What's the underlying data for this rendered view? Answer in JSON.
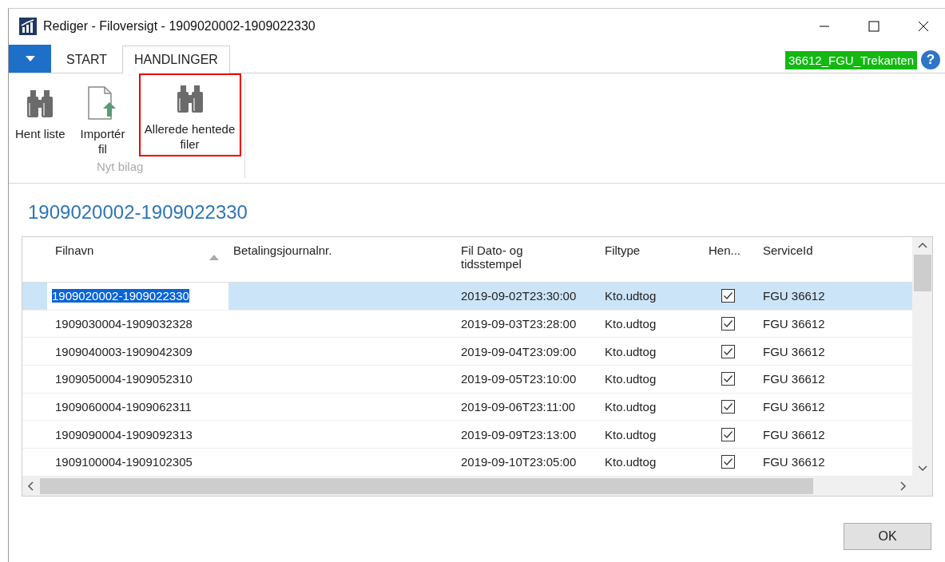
{
  "window": {
    "title": "Rediger - Filoversigt - 1909020002-1909022330"
  },
  "tabs": [
    {
      "label": "START",
      "selected": false
    },
    {
      "label": "HANDLINGER",
      "selected": true
    }
  ],
  "company_badge": "36612_FGU_Trekanten",
  "help_button": "?",
  "ribbon": {
    "actions": [
      {
        "label": "Hent liste",
        "kind": "binoculars",
        "highlighted": false
      },
      {
        "label": "Importér fil",
        "kind": "import",
        "highlighted": false
      },
      {
        "label": "Allerede hentede filer",
        "kind": "binoculars",
        "highlighted": true
      }
    ],
    "group_label": "Nyt bilag"
  },
  "page_title": "1909020002-1909022330",
  "table": {
    "columns": [
      "Filnavn",
      "Betalingsjournalnr.",
      "Fil Dato- og tidsstempel",
      "Filtype",
      "Hen...",
      "ServiceId"
    ],
    "rows": [
      {
        "filnavn": "1909020002-1909022330",
        "betalingsjournalnr": "",
        "timestamp": "2019-09-02T23:30:00",
        "filtype": "Kto.udtog",
        "hentet": true,
        "service_id": "FGU 36612",
        "selected": true
      },
      {
        "filnavn": "1909030004-1909032328",
        "timestamp": "2019-09-03T23:28:00",
        "filtype": "Kto.udtog",
        "hentet": true,
        "service_id": "FGU 36612",
        "selected": false
      },
      {
        "filnavn": "1909040003-1909042309",
        "timestamp": "2019-09-04T23:09:00",
        "filtype": "Kto.udtog",
        "hentet": true,
        "service_id": "FGU 36612",
        "selected": false
      },
      {
        "filnavn": "1909050004-1909052310",
        "timestamp": "2019-09-05T23:10:00",
        "filtype": "Kto.udtog",
        "hentet": true,
        "service_id": "FGU 36612",
        "selected": false
      },
      {
        "filnavn": "1909060004-1909062311",
        "timestamp": "2019-09-06T23:11:00",
        "filtype": "Kto.udtog",
        "hentet": true,
        "service_id": "FGU 36612",
        "selected": false
      },
      {
        "filnavn": "1909090004-1909092313",
        "timestamp": "2019-09-09T23:13:00",
        "filtype": "Kto.udtog",
        "hentet": true,
        "service_id": "FGU 36612",
        "selected": false
      },
      {
        "filnavn": "1909100004-1909102305",
        "timestamp": "2019-09-10T23:05:00",
        "filtype": "Kto.udtog",
        "hentet": true,
        "service_id": "FGU 36612",
        "selected": false
      }
    ]
  },
  "buttons": [
    "OK"
  ]
}
